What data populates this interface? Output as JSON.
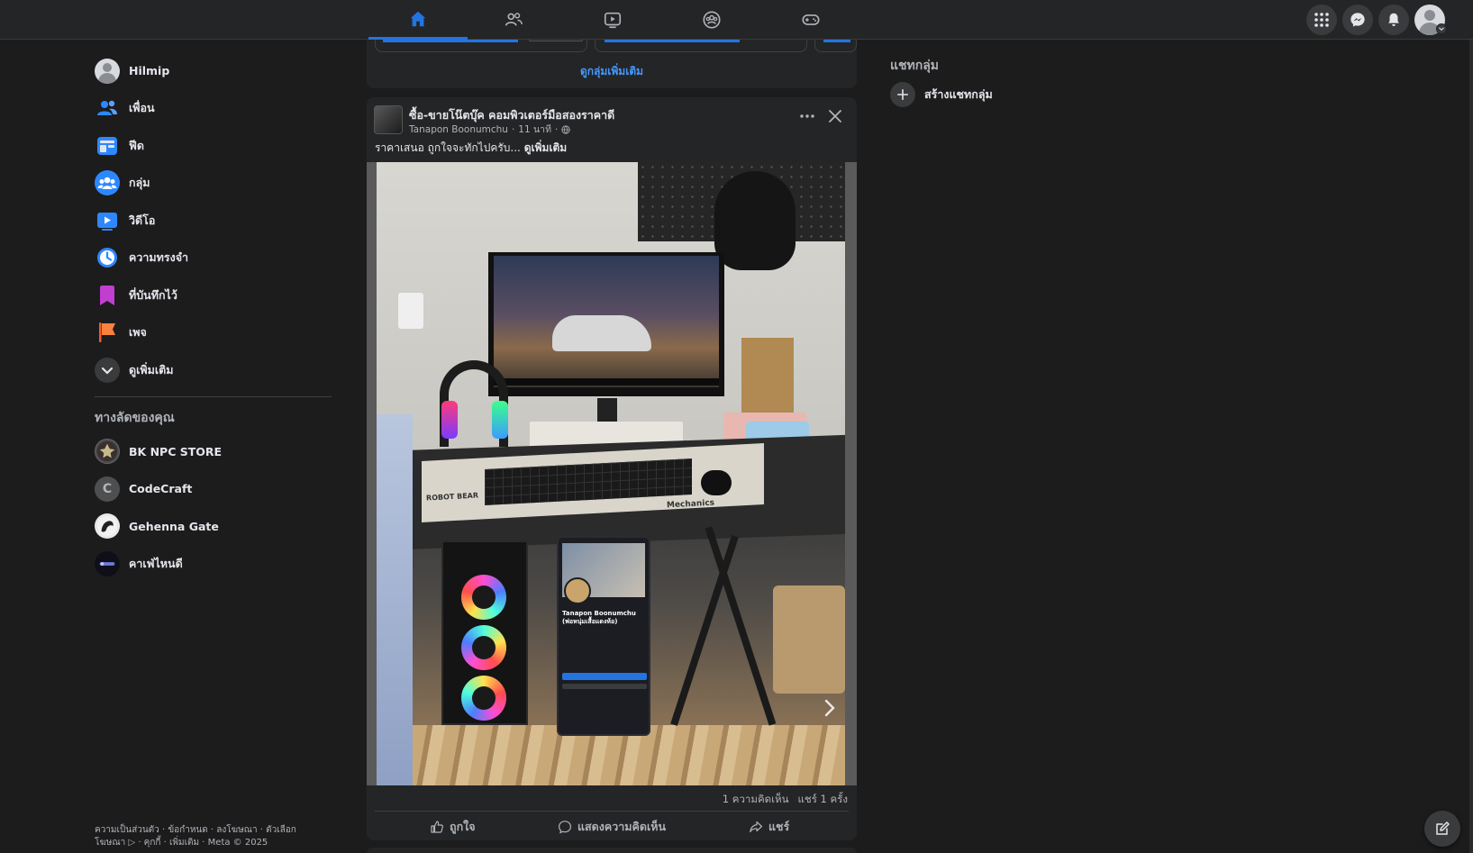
{
  "topbar": {
    "nav_tabs": [
      {
        "name": "home",
        "icon": "home-icon",
        "active": true
      },
      {
        "name": "friends",
        "icon": "friends-icon",
        "active": false
      },
      {
        "name": "video",
        "icon": "video-icon",
        "active": false
      },
      {
        "name": "groups",
        "icon": "groups-icon",
        "active": false
      },
      {
        "name": "gaming",
        "icon": "gaming-icon",
        "active": false
      }
    ],
    "right_buttons": [
      "menu-grid-icon",
      "messenger-icon",
      "notifications-icon",
      "profile-avatar"
    ]
  },
  "sidebar": {
    "items": [
      {
        "label": "Hilmip",
        "icon": "profile-avatar"
      },
      {
        "label": "เพื่อน",
        "icon": "friends-icon"
      },
      {
        "label": "ฟีด",
        "icon": "feed-icon"
      },
      {
        "label": "กลุ่ม",
        "icon": "groups-icon"
      },
      {
        "label": "วิดีโอ",
        "icon": "video-icon"
      },
      {
        "label": "ความทรงจำ",
        "icon": "memories-icon"
      },
      {
        "label": "ที่บันทึกไว้",
        "icon": "saved-icon"
      },
      {
        "label": "เพจ",
        "icon": "pages-icon"
      },
      {
        "label": "ดูเพิ่มเติม",
        "icon": "chevron-down-icon"
      }
    ],
    "shortcuts_title": "ทางลัดของคุณ",
    "shortcuts": [
      {
        "label": "BK NPC STORE",
        "avatar": "bk-npc-store-avatar"
      },
      {
        "label": "CodeCraft",
        "avatar_letter": "C"
      },
      {
        "label": "Gehenna Gate",
        "avatar": "gehenna-gate-avatar"
      },
      {
        "label": "คาเฟ่ไหนดี",
        "avatar": "cafe-avatar"
      }
    ],
    "footer": "ความเป็นส่วนตัว · ข้อกำหนด · ลงโฆษณา · ตัวเลือกโฆษณา ▷ · คุกกี้ · เพิ่มเติม · Meta © 2025"
  },
  "feed": {
    "top_card_link": "ดูกลุ่มเพิ่มเติม",
    "post": {
      "group_name": "ซื้อ-ขายโน๊ตบุ๊ค คอมพิวเตอร์มือสองราคาดี",
      "author": "Tanapon Boonumchu",
      "time": "11 นาที",
      "text": "ราคาเสนอ ถูกใจจะทักไปครับ...",
      "see_more": "ดูเพิ่มเติม",
      "comments_count": "1 ความคิดเห็น",
      "shares_count": "แชร์ 1 ครั้ง",
      "actions": {
        "like": "ถูกใจ",
        "comment": "แสดงความคิดเห็น",
        "share": "แชร์"
      },
      "screen_overlay_name": "Tanapon Boonumchu (พ่อหนุ่มเสื้อแดงห้อ)",
      "mat_text": "ROBOT BEAR",
      "mat_text2": "Mechanics"
    }
  },
  "right": {
    "title": "แชทกลุ่ม",
    "create_group_chat": "สร้างแชทกลุ่ม"
  },
  "colors": {
    "accent": "#2374e1",
    "link": "#4599ff",
    "background": "#1c1c1d",
    "card": "#242526"
  }
}
